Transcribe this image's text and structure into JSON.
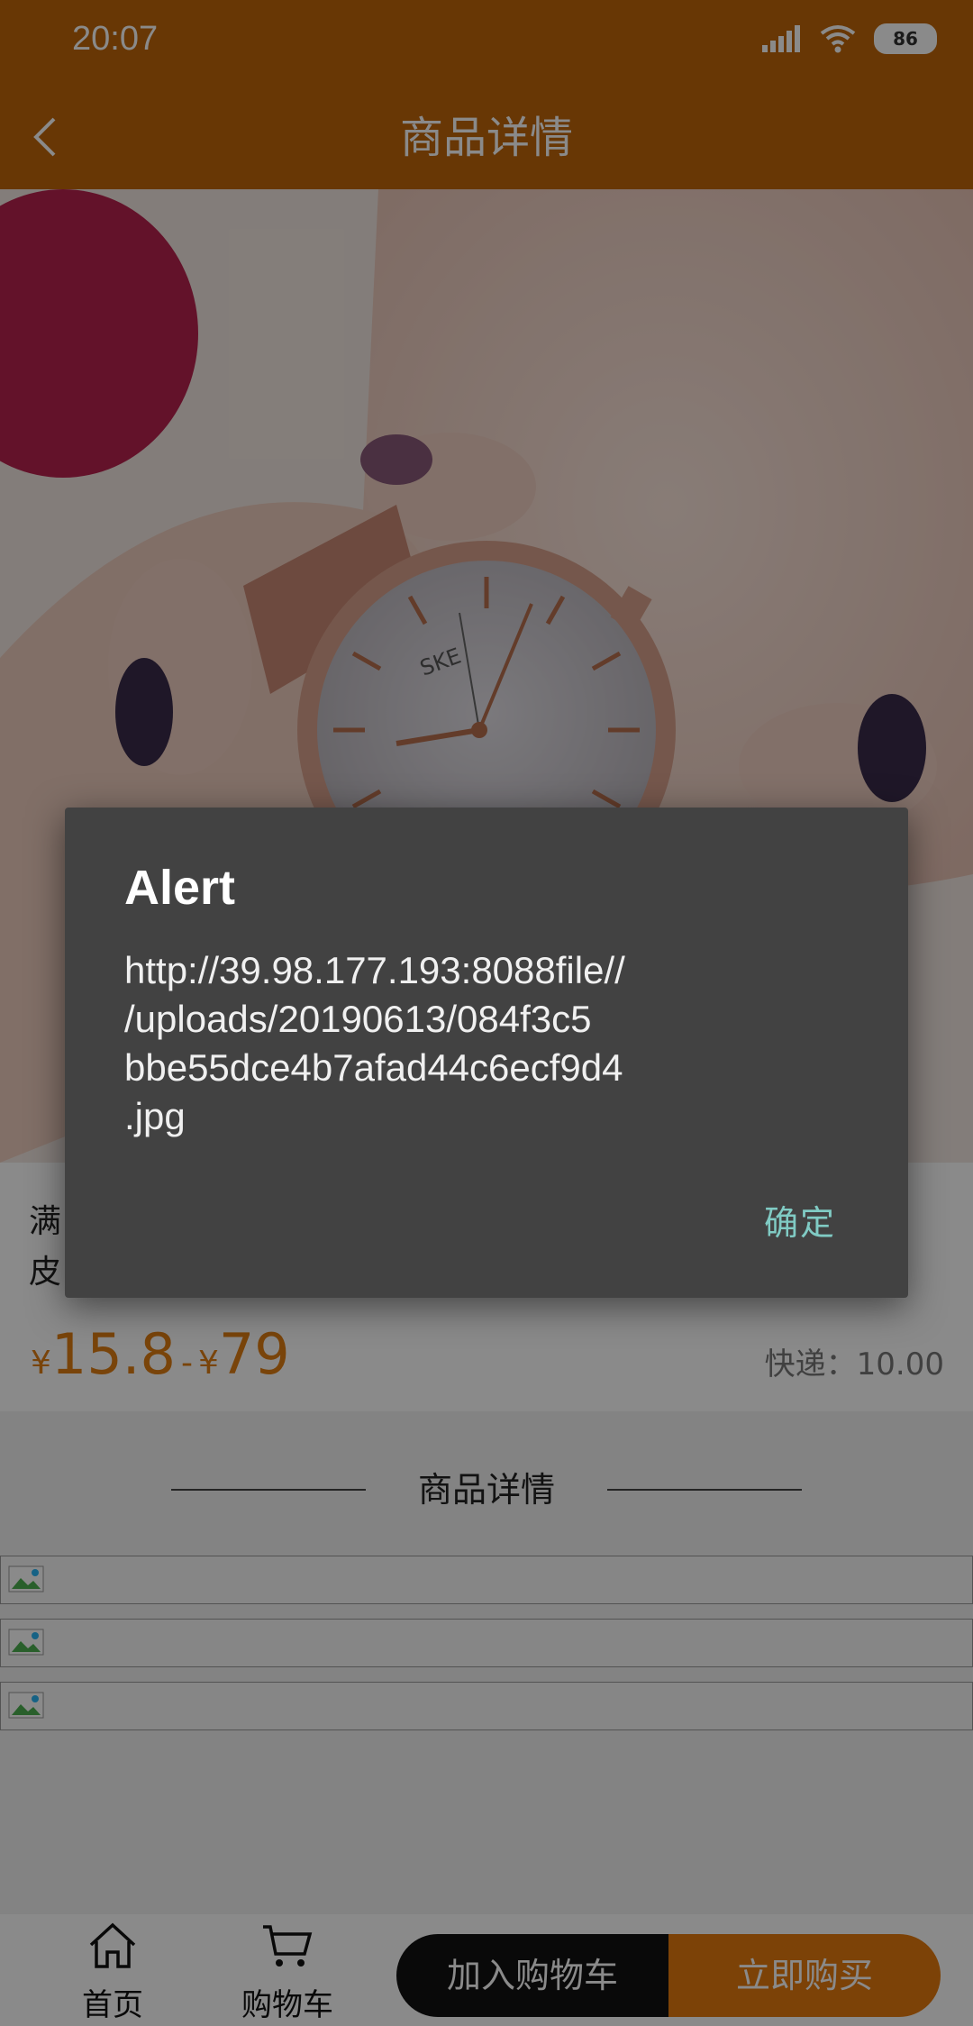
{
  "status_bar": {
    "time": "20:07",
    "battery": "86"
  },
  "header": {
    "title": "商品详情"
  },
  "product": {
    "name": "满                                                                                             生\n皮",
    "price_symbol": "¥",
    "price_min": "15.8",
    "price_sep": "-",
    "price_max": "79",
    "shipping": "快递：10.00"
  },
  "details": {
    "section_title": "商品详情"
  },
  "bottom_bar": {
    "home_label": "首页",
    "cart_label": "购物车",
    "add_to_cart": "加入购物车",
    "buy_now": "立即购买"
  },
  "dialog": {
    "title": "Alert",
    "message": "http://39.98.177.193:8088file//\n/uploads/20190613/084f3c5\nbbe55dce4b7afad44c6ecf9d4\n.jpg",
    "ok_label": "确定"
  },
  "colors": {
    "brand": "#C0660B",
    "price": "#E07E14",
    "buy": "#E57A0E",
    "dialog_bg": "#424242",
    "dialog_ok": "#80CBC4"
  }
}
